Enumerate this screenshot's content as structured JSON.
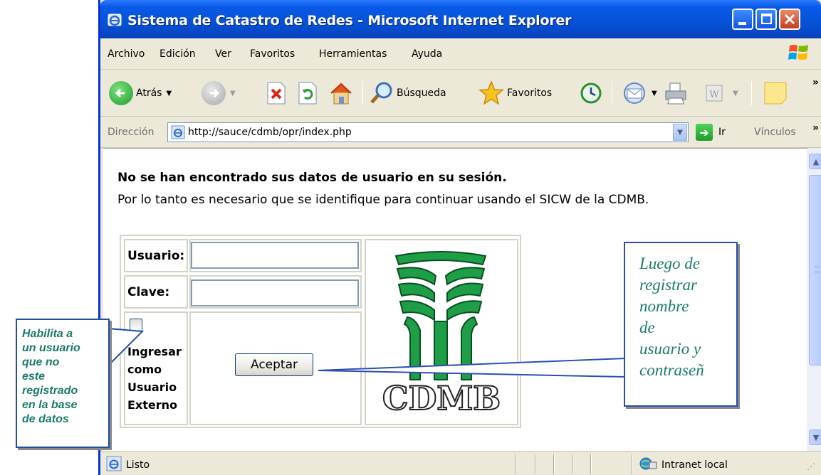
{
  "window": {
    "title": "Sistema de Catastro de Redes - Microsoft Internet Explorer"
  },
  "menu": {
    "items": [
      "Archivo",
      "Edición",
      "Ver",
      "Favoritos",
      "Herramientas",
      "Ayuda"
    ]
  },
  "toolbar": {
    "back_label": "Atrás",
    "search_label": "Búsqueda",
    "favorites_label": "Favoritos",
    "overflow": "»"
  },
  "address": {
    "label": "Dirección",
    "url": "http://sauce/cdmb/opr/index.php",
    "go_label": "Ir",
    "links_label": "Vínculos",
    "overflow": "»"
  },
  "page": {
    "heading": "No se han encontrado sus datos de usuario en su sesión.",
    "message": "Por lo tanto es necesario que se identifique para continuar usando el SICW de la CDMB.",
    "form": {
      "user_label": "Usuario:",
      "user_value": "",
      "password_label": "Clave:",
      "password_value": "",
      "external_label_lines": [
        "Ingresar",
        "como",
        "Usuario",
        "Externo"
      ],
      "submit_label": "Aceptar"
    },
    "logo_text": "CDMB",
    "logo_green": "#1e9e46"
  },
  "status": {
    "text": "Listo",
    "zone": "Intranet local"
  },
  "callouts": {
    "left_lines": [
      "Habilita a",
      "un usuario",
      "que no",
      "este",
      "registrado",
      "en la base",
      "de datos"
    ],
    "right_lines": [
      "Luego de",
      "registrar",
      "nombre",
      "de",
      "usuario y",
      "contraseñ"
    ],
    "text_color": "#1a7a6b"
  }
}
